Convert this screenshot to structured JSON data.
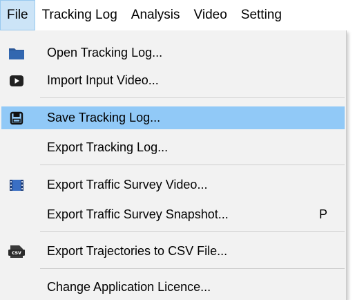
{
  "menubar": {
    "items": [
      {
        "label": "File"
      },
      {
        "label": "Tracking Log"
      },
      {
        "label": "Analysis"
      },
      {
        "label": "Video"
      },
      {
        "label": "Setting"
      }
    ]
  },
  "file_menu": {
    "open_log": {
      "label": "Open Tracking Log...",
      "icon": "folder-icon"
    },
    "import_video": {
      "label": "Import Input Video...",
      "icon": "video-play-icon"
    },
    "save_log": {
      "label": "Save Tracking Log...",
      "icon": "save-disk-icon"
    },
    "export_log": {
      "label": "Export Tracking Log..."
    },
    "export_video": {
      "label": "Export Traffic Survey Video...",
      "icon": "film-strip-icon"
    },
    "export_snapshot": {
      "label": "Export Traffic Survey Snapshot...",
      "shortcut": "P"
    },
    "export_csv": {
      "label": "Export Trajectories to CSV File...",
      "icon": "csv-file-icon",
      "icon_text": "csv"
    },
    "change_licence": {
      "label": "Change Application Licence..."
    }
  },
  "colors": {
    "highlight": "#91c9f7",
    "menu_background": "#f2f2f2",
    "active_menubar": "#cce4f7",
    "folder_icon": "#2b5797"
  }
}
